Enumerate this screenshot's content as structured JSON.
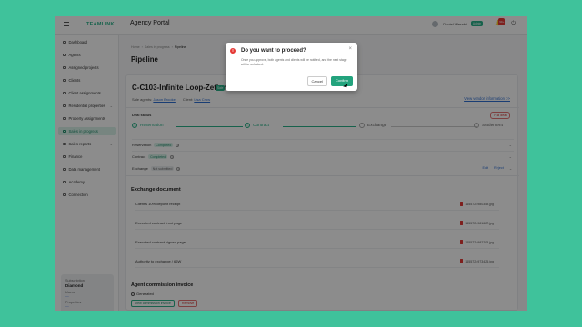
{
  "header": {
    "logo_text": "TEAMLINK",
    "portal_title": "Agency Portal",
    "user_name": "Daniel Wasabi",
    "user_role": "Admin",
    "notification_count": "99+"
  },
  "sidebar": {
    "items": [
      {
        "label": "Dashboard"
      },
      {
        "label": "Agents"
      },
      {
        "label": "Assigned projects"
      },
      {
        "label": "Clients"
      },
      {
        "label": "Client assignments"
      },
      {
        "label": "Residential properties"
      },
      {
        "label": "Property assignments"
      },
      {
        "label": "Sales in progress"
      },
      {
        "label": "Sales reports"
      },
      {
        "label": "Finance"
      },
      {
        "label": "Data management"
      },
      {
        "label": "Academy"
      },
      {
        "label": "Connection"
      }
    ],
    "active_index": 7,
    "subscription": {
      "label": "Subscription",
      "plan": "Diamond",
      "users_label": "Users",
      "users_value": "—",
      "properties_label": "Properties",
      "properties_value": "—"
    }
  },
  "breadcrumb": [
    "Home",
    "Sales in progress",
    "Pipeline"
  ],
  "page_title": "Pipeline",
  "deal": {
    "title": "C-C103-Infinite Loop-Zetland",
    "badge": "Sale",
    "sale_agents_label": "Sale agents:",
    "sale_agents_value": "Jason Brooke",
    "client_label": "Client:",
    "client_value": "Lisa Crow",
    "vendor_link": "View vendor information >>"
  },
  "deal_status": {
    "label": "Deal status",
    "failed_button": "Fail deal"
  },
  "stepper": [
    {
      "label": "Reservation",
      "done": true
    },
    {
      "label": "Contract",
      "done": true
    },
    {
      "label": "Exchange",
      "done": false
    },
    {
      "label": "Settlement",
      "done": false
    }
  ],
  "stage_rows": [
    {
      "label": "Reservation",
      "status": "Completed",
      "ok": true
    },
    {
      "label": "Contract",
      "status": "Completed",
      "ok": true
    },
    {
      "label": "Exchange",
      "status": "Not submitted",
      "ok": false,
      "edit": "Edit",
      "reject": "Reject"
    }
  ],
  "exchange_document": {
    "title": "Exchange document",
    "rows": [
      {
        "label": "Client's 10% deposit receipt",
        "file": "1655724980359.jpg"
      },
      {
        "label": "Executed contract front page",
        "file": "1655724981627.jpg"
      },
      {
        "label": "Executed contract signed page",
        "file": "1655724982204.jpg"
      },
      {
        "label": "Authority to exchange / 66W",
        "file": "1655724973425.jpg"
      }
    ]
  },
  "agent_commission": {
    "title": "Agent commission invoice",
    "generated_label": "Generated",
    "view_button": "View commission invoice",
    "remove_button": "Remove"
  },
  "modal": {
    "title": "Do you want to proceed?",
    "text": "Once you approve, both agents and clients will be notified, and the next stage will be unlocked.",
    "cancel": "Cancel",
    "confirm": "Confirm"
  },
  "colors": {
    "accent": "#2ab38a",
    "danger": "#e53935",
    "link": "#2f6fd4",
    "background": "#3fc29b"
  }
}
